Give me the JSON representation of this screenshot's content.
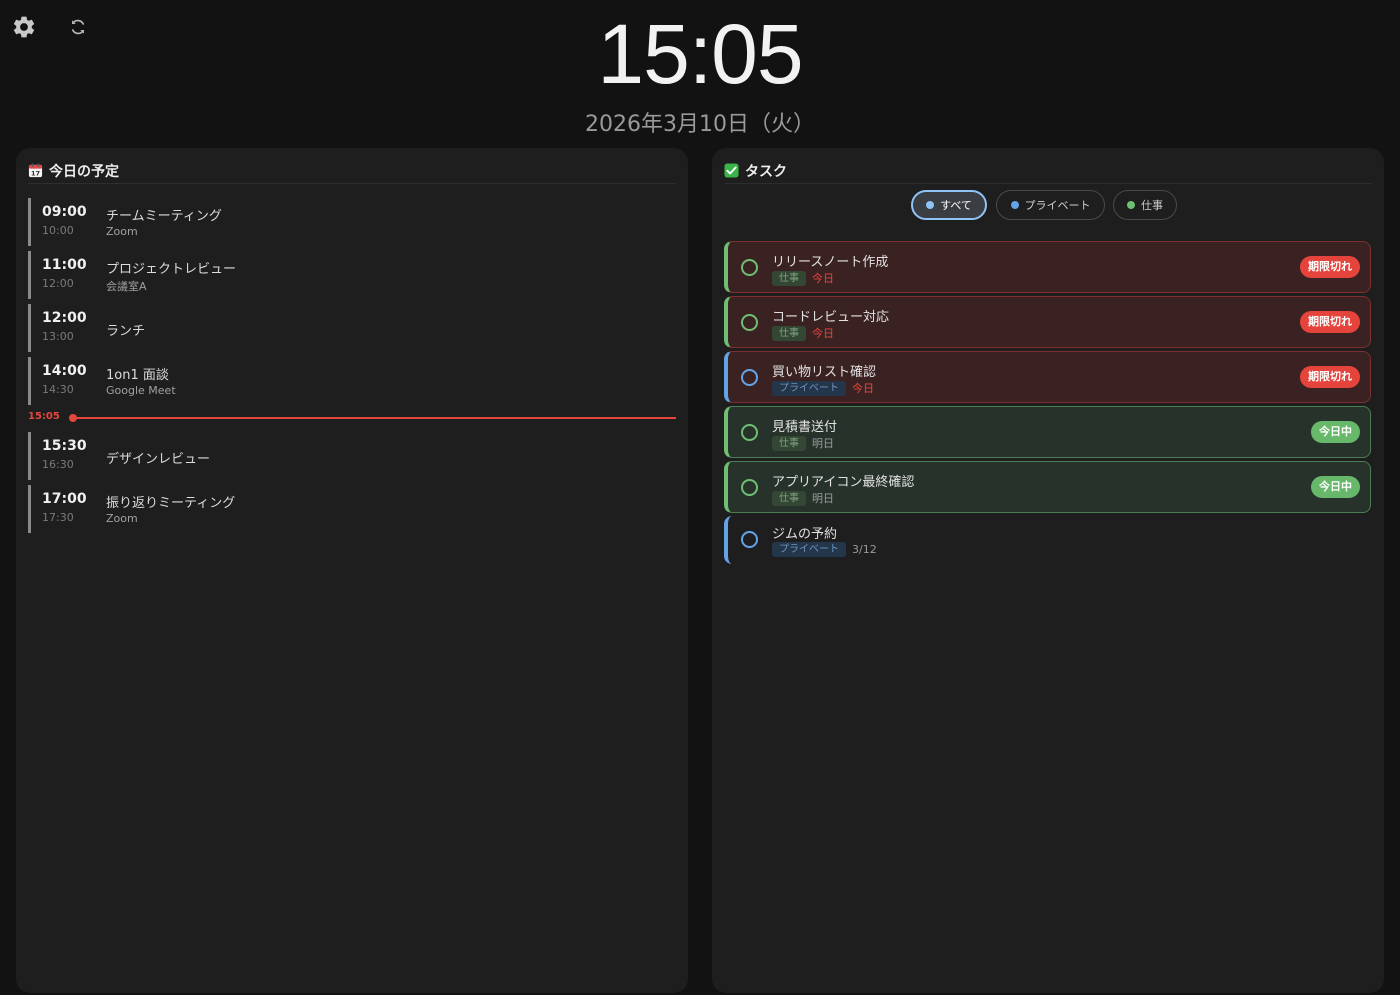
{
  "toolbar": {
    "settings_icon": "gear-icon",
    "refresh_icon": "refresh-icon"
  },
  "clock": {
    "time": "15:05",
    "date": "2026年3月10日（火）"
  },
  "schedule": {
    "title": "今日の予定",
    "icon": "calendar-icon",
    "events": [
      {
        "start": "09:00",
        "end": "10:00",
        "title": "チームミーティング",
        "location": "Zoom"
      },
      {
        "start": "11:00",
        "end": "12:00",
        "title": "プロジェクトレビュー",
        "location": "会議室A"
      },
      {
        "start": "12:00",
        "end": "13:00",
        "title": "ランチ",
        "location": ""
      },
      {
        "start": "14:00",
        "end": "14:30",
        "title": "1on1 面談",
        "location": "Google Meet"
      },
      {
        "start": "15:30",
        "end": "16:30",
        "title": "デザインレビュー",
        "location": ""
      },
      {
        "start": "17:00",
        "end": "17:30",
        "title": "振り返りミーティング",
        "location": "Zoom"
      }
    ],
    "now_label": "15:05"
  },
  "tasks": {
    "title": "タスク",
    "icon": "checkbox-icon",
    "filters": [
      {
        "label": "すべて",
        "dot_color": "#8ec4f5",
        "active": true
      },
      {
        "label": "プライベート",
        "dot_color": "#63a4e8",
        "active": false
      },
      {
        "label": "仕事",
        "dot_color": "#6fbf73",
        "active": false
      }
    ],
    "items": [
      {
        "title": "リリースノート作成",
        "tag": "仕事",
        "due": "今日",
        "badge": "期限切れ",
        "state": "overdue"
      },
      {
        "title": "コードレビュー対応",
        "tag": "仕事",
        "due": "今日",
        "badge": "期限切れ",
        "state": "overdue"
      },
      {
        "title": "買い物リスト確認",
        "tag": "プライベート",
        "due": "今日",
        "badge": "期限切れ",
        "state": "overdue"
      },
      {
        "title": "見積書送付",
        "tag": "仕事",
        "due": "明日",
        "badge": "今日中",
        "state": "today"
      },
      {
        "title": "アプリアイコン最終確認",
        "tag": "仕事",
        "due": "明日",
        "badge": "今日中",
        "state": "today"
      },
      {
        "title": "ジムの予約",
        "tag": "プライベート",
        "due": "3/12",
        "badge": "",
        "state": "plain"
      }
    ]
  },
  "colors": {
    "background": "#121212",
    "panel": "#1e1e1e",
    "accent_red": "#e5473e",
    "work_green": "#6fbf73",
    "private_blue": "#63a4e8"
  }
}
